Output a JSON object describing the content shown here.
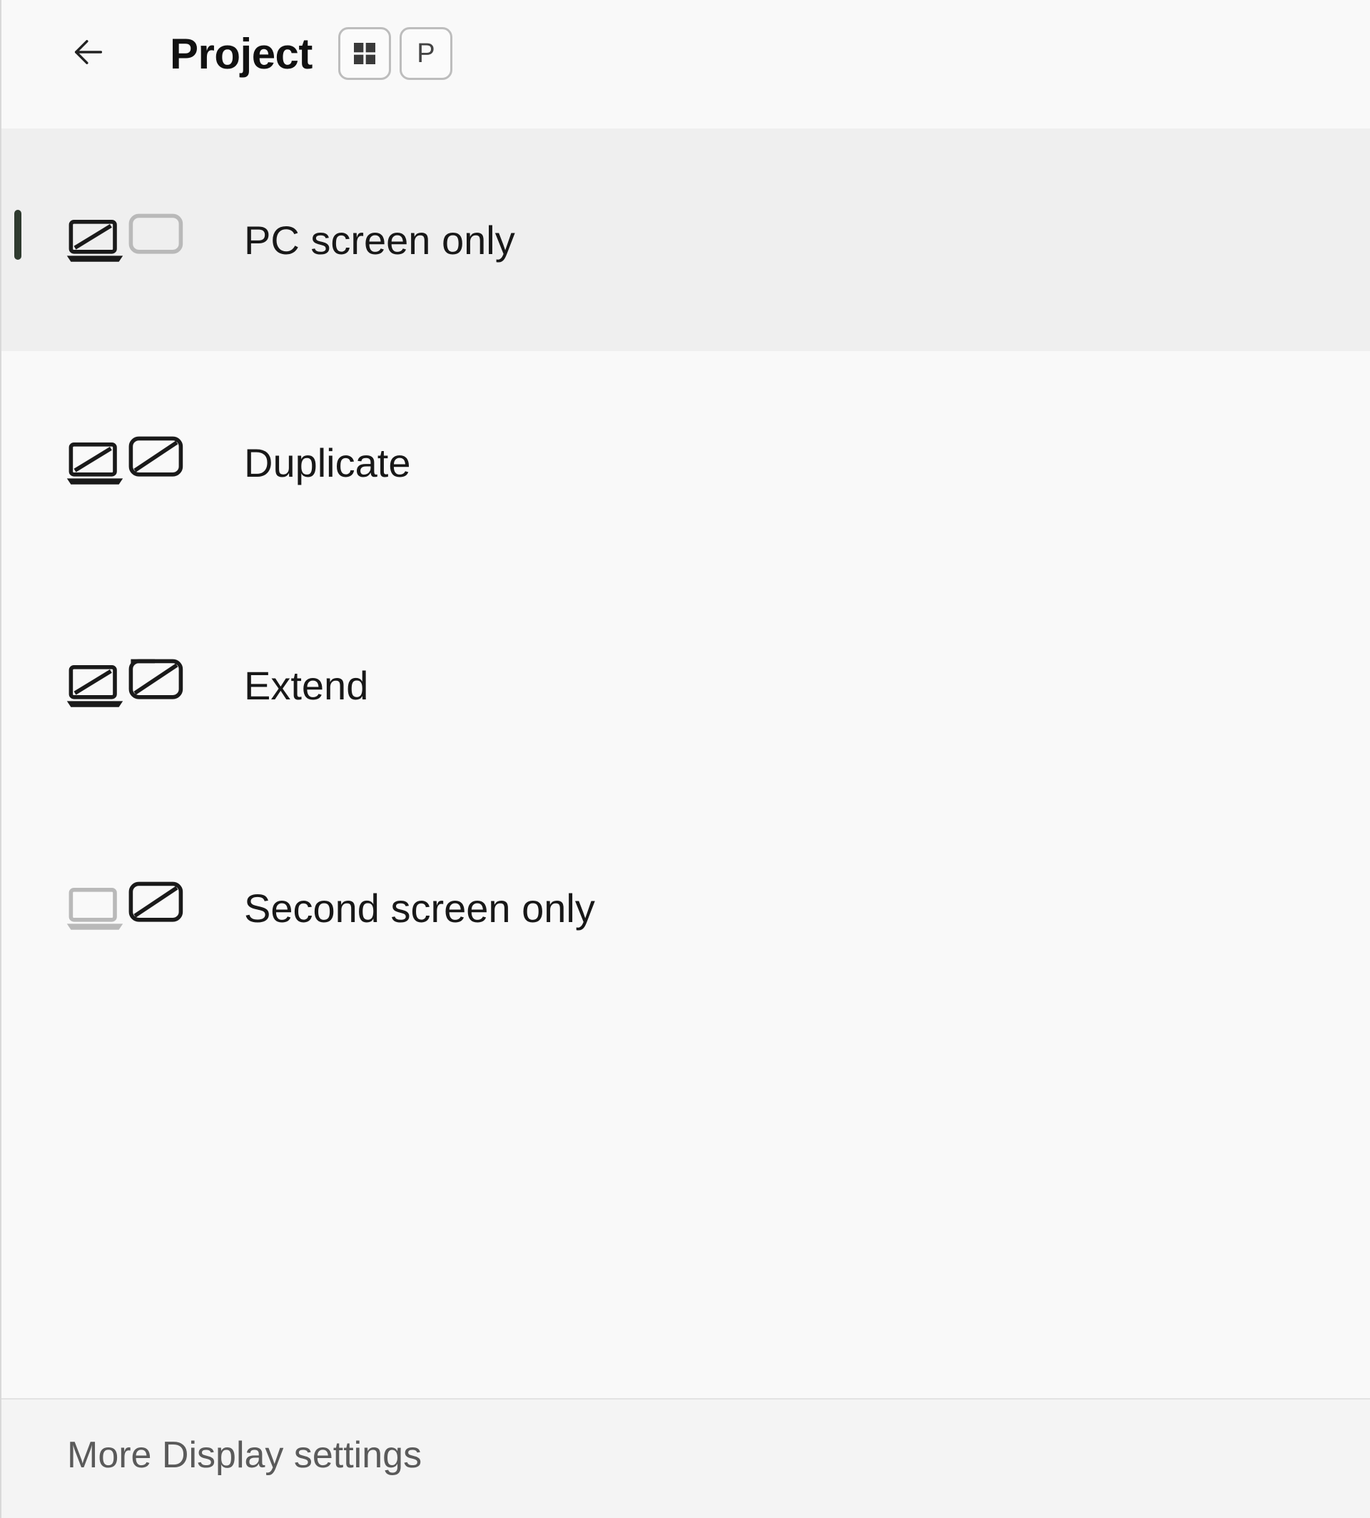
{
  "header": {
    "title": "Project",
    "shortcut_key": "P"
  },
  "options": [
    {
      "label": "PC screen only",
      "selected": true
    },
    {
      "label": "Duplicate",
      "selected": false
    },
    {
      "label": "Extend",
      "selected": false
    },
    {
      "label": "Second screen only",
      "selected": false
    }
  ],
  "footer": {
    "link_label": "More Display settings"
  },
  "icons": {
    "back": "back-arrow-icon",
    "win": "windows-logo-icon",
    "opt0": "pc-screen-only-icon",
    "opt1": "duplicate-icon",
    "opt2": "extend-icon",
    "opt3": "second-screen-only-icon"
  }
}
